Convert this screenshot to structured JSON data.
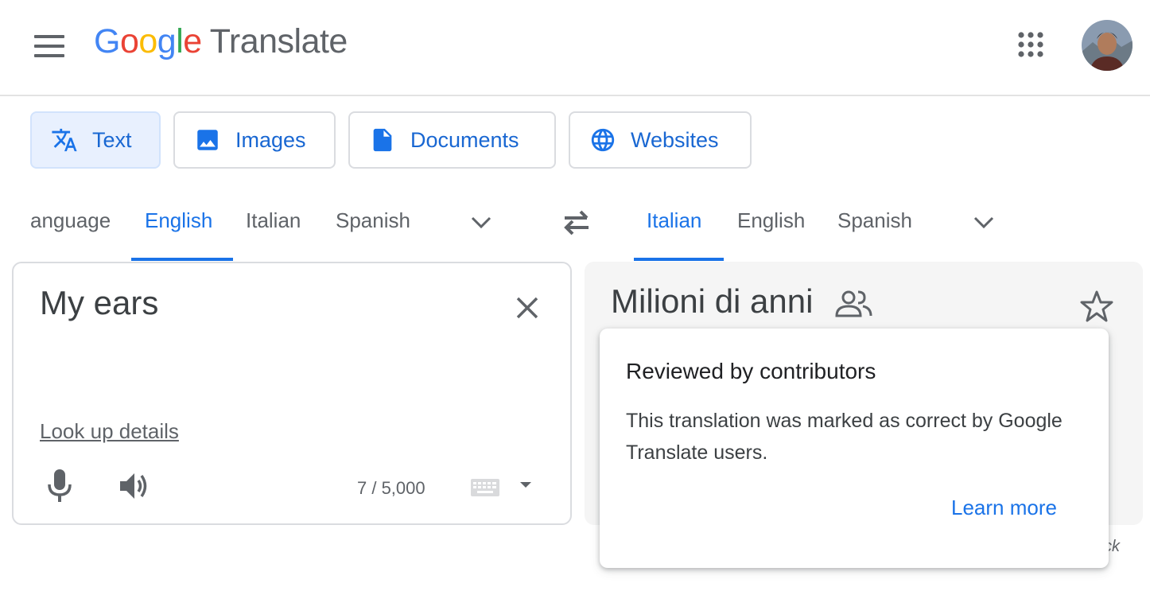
{
  "app": {
    "logo_letters": [
      "G",
      "o",
      "o",
      "g",
      "l",
      "e"
    ],
    "product_name": "Translate"
  },
  "mode_tabs": [
    {
      "label": "Text",
      "icon": "translate-icon",
      "active": true
    },
    {
      "label": "Images",
      "icon": "image-icon",
      "active": false
    },
    {
      "label": "Documents",
      "icon": "document-icon",
      "active": false
    },
    {
      "label": "Websites",
      "icon": "globe-icon",
      "active": false
    }
  ],
  "source_languages": [
    {
      "label": "anguage",
      "active": false
    },
    {
      "label": "English",
      "active": true
    },
    {
      "label": "Italian",
      "active": false
    },
    {
      "label": "Spanish",
      "active": false
    }
  ],
  "target_languages": [
    {
      "label": "Italian",
      "active": true
    },
    {
      "label": "English",
      "active": false
    },
    {
      "label": "Spanish",
      "active": false
    }
  ],
  "source": {
    "text": "My ears",
    "lookup_label": "Look up details",
    "char_count": "7 / 5,000"
  },
  "target": {
    "text": "Milioni di anni",
    "feedback_partial": "ck"
  },
  "popup": {
    "title": "Reviewed by contributors",
    "body": "This translation was marked as correct by Google Translate users.",
    "link": "Learn more"
  },
  "colors": {
    "accent": "#1a73e8",
    "active_tab_bg": "#e8f0fe",
    "target_bg": "#f5f5f5"
  }
}
